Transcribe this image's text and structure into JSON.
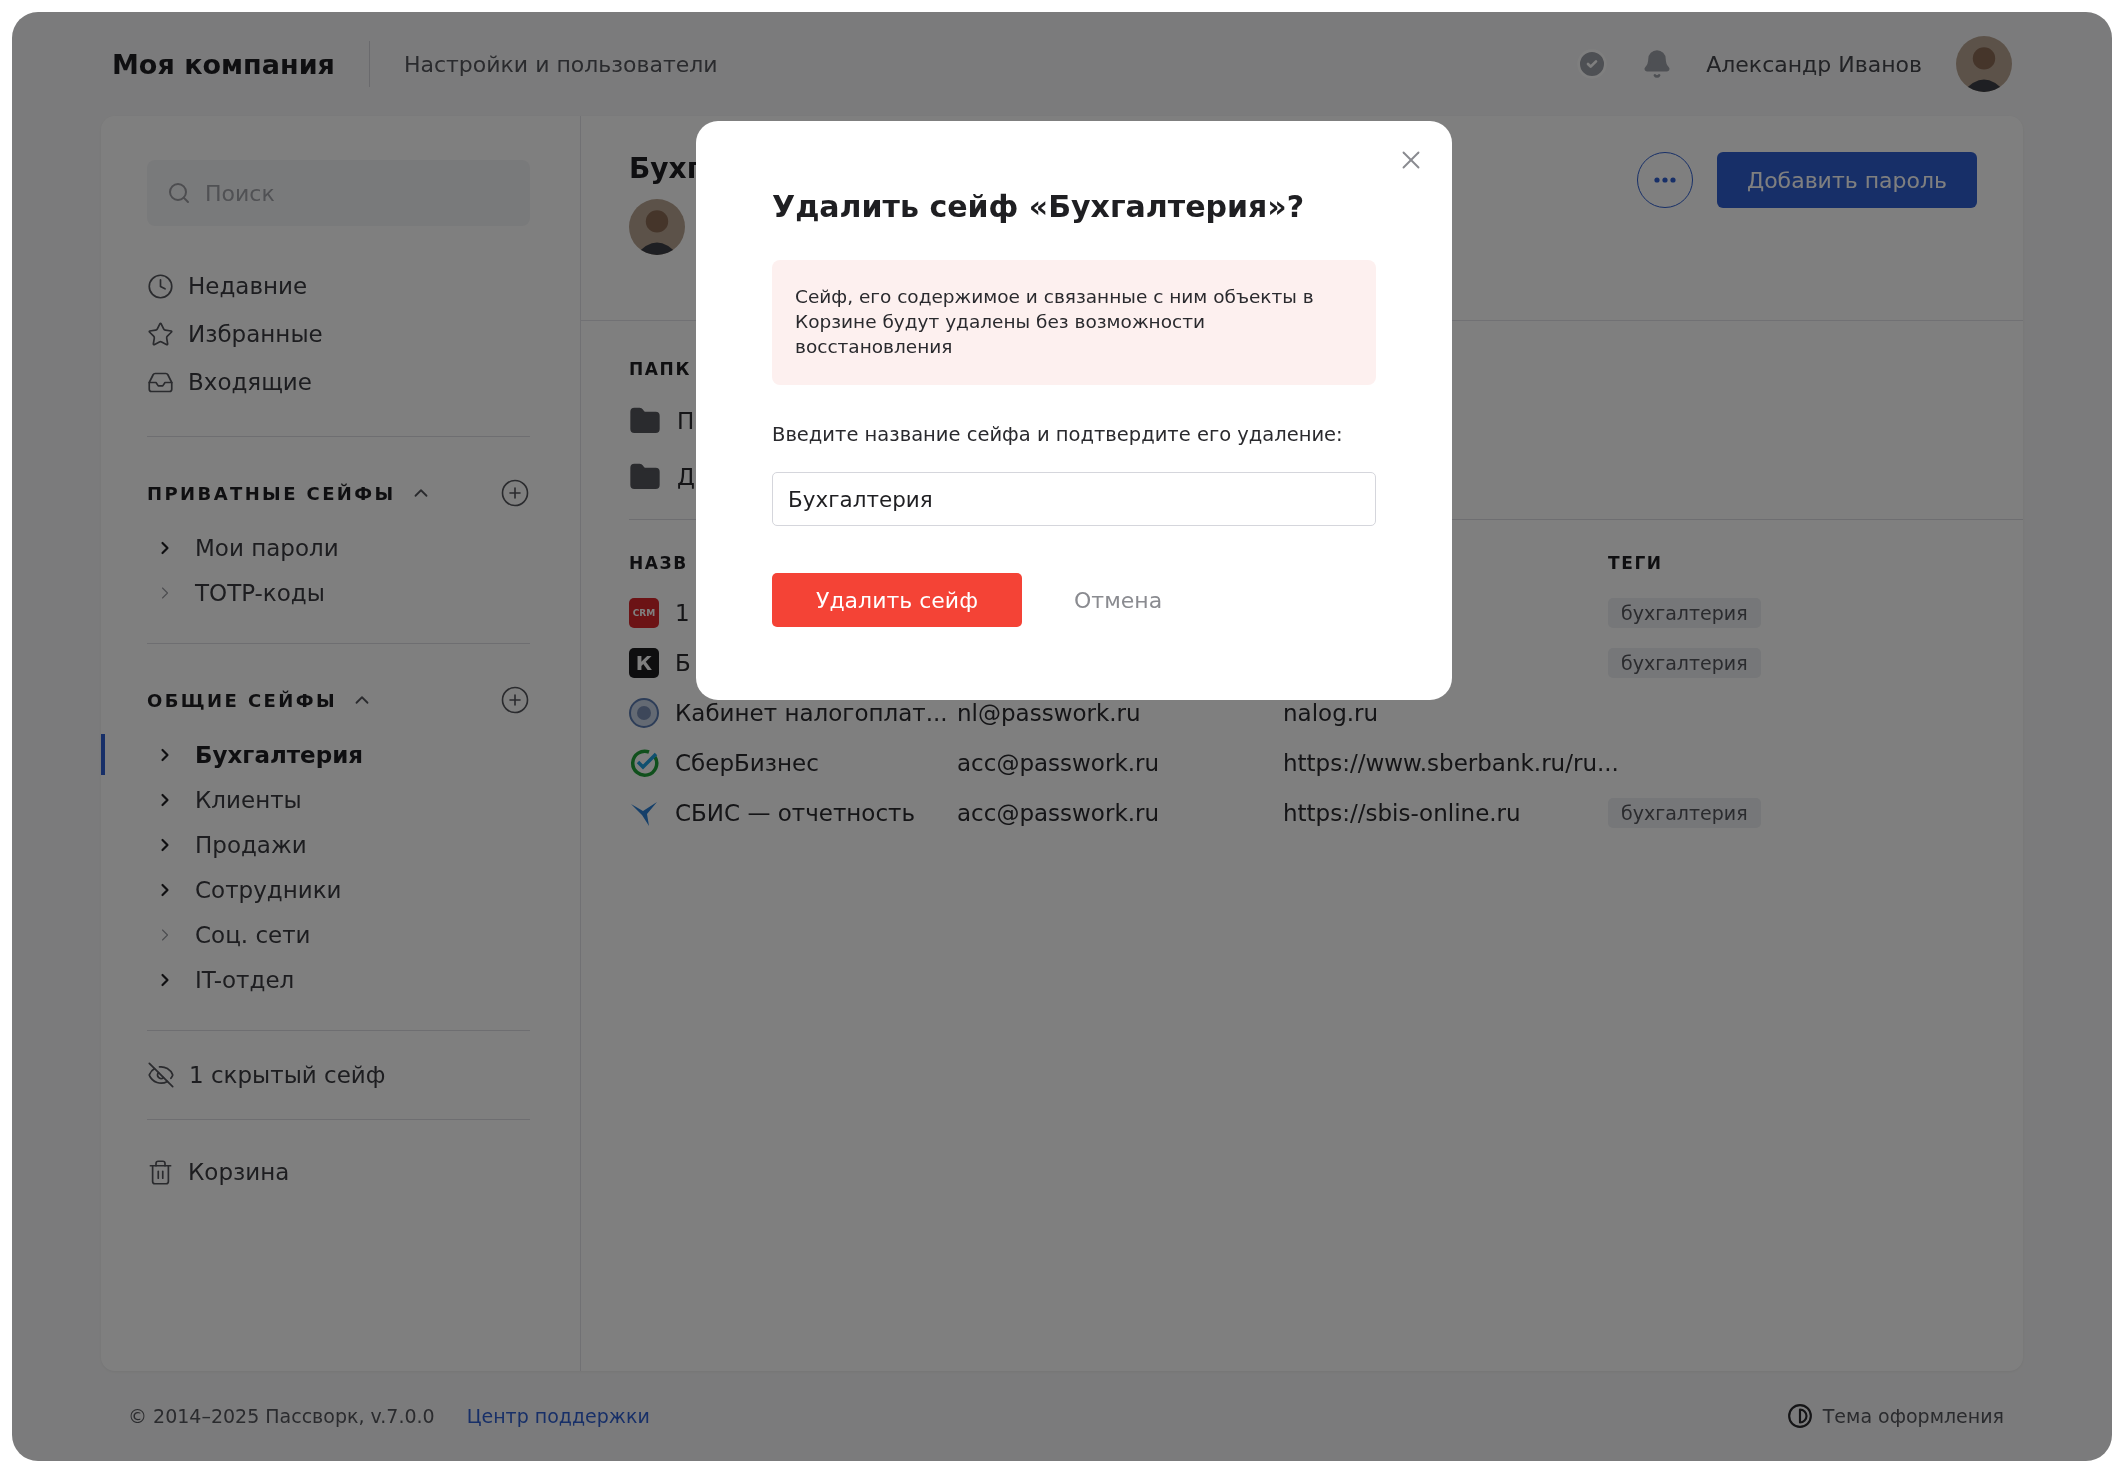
{
  "header": {
    "company": "Моя компания",
    "section": "Настройки и пользователи",
    "user_name": "Александр Иванов"
  },
  "sidebar": {
    "search": {
      "placeholder": "Поиск"
    },
    "nav": [
      {
        "label": "Недавние",
        "kind": "recent"
      },
      {
        "label": "Избранные",
        "kind": "favorites"
      },
      {
        "label": "Входящие",
        "kind": "inbox"
      }
    ],
    "groups": [
      {
        "title": "ПРИВАТНЫЕ СЕЙФЫ",
        "expanded": true,
        "items": [
          {
            "label": "Мои пароли",
            "expandable": true,
            "selected": false
          },
          {
            "label": "TOTP-коды",
            "expandable": false,
            "selected": false
          }
        ]
      },
      {
        "title": "ОБЩИЕ СЕЙФЫ",
        "expanded": true,
        "items": [
          {
            "label": "Бухгалтерия",
            "expandable": true,
            "selected": true
          },
          {
            "label": "Клиенты",
            "expandable": true,
            "selected": false
          },
          {
            "label": "Продажи",
            "expandable": true,
            "selected": false
          },
          {
            "label": "Сотрудники",
            "expandable": true,
            "selected": false
          },
          {
            "label": "Соц. сети",
            "expandable": false,
            "selected": false
          },
          {
            "label": "IT-отдел",
            "expandable": true,
            "selected": false
          }
        ]
      }
    ],
    "hidden": "1 скрытый сейф",
    "trash": "Корзина"
  },
  "content": {
    "title": "Бухг",
    "add_button": "Добавить пароль",
    "folders_heading": "ПАПК",
    "folders": [
      "П",
      "Д"
    ],
    "columns": {
      "column_1": "НАЗВ",
      "tags": "ТЕГИ"
    },
    "rows": [
      {
        "icon": {
          "kind": "crm",
          "text": "CRM"
        },
        "name": "1",
        "tag": "бухгалтерия"
      },
      {
        "icon": {
          "kind": "letter",
          "text": "К"
        },
        "name": "Б",
        "tag": "бухгалтерия"
      },
      {
        "icon": {
          "kind": "emblem"
        },
        "name": "Кабинет налогоплат...",
        "login": "nl@passwork.ru",
        "url": "nalog.ru"
      },
      {
        "icon": {
          "kind": "check-ring"
        },
        "name": "СберБизнес",
        "login": "acc@passwork.ru",
        "url": "https://www.sberbank.ru/ru..."
      },
      {
        "icon": {
          "kind": "bird"
        },
        "name": "СБИС — отчетность",
        "login": "acc@passwork.ru",
        "url": "https://sbis-online.ru",
        "tag": "бухгалтерия"
      }
    ]
  },
  "footer": {
    "copyright": "© 2014–2025 Пассворк, v.7.0.0",
    "support_link": "Центр поддержки",
    "theme": "Тема оформления"
  },
  "dialog": {
    "title": "Удалить сейф «Бухгалтерия»?",
    "warning": "Сейф, его содержимое и связанные с ним объекты в Корзине будут удалены без возможности восстановления",
    "prompt": "Введите название сейфа и подтвердите его удаление:",
    "input_value": "Бухгалтерия",
    "confirm": "Удалить сейф",
    "cancel": "Отмена"
  }
}
